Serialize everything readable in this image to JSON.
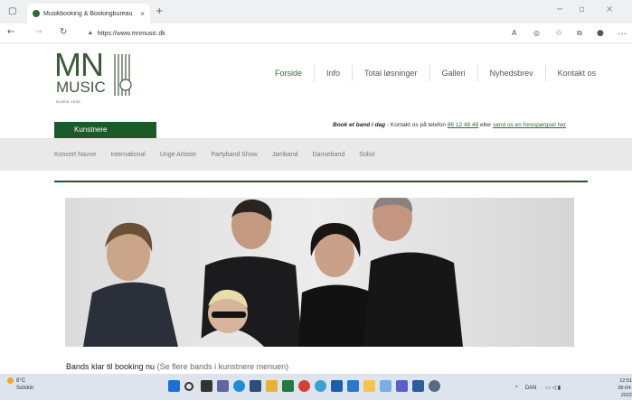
{
  "browser": {
    "tab_title": "Musikbooking & Bookingbureau",
    "url": "https://www.mnmusic.dk",
    "icons": [
      "tabs-icon",
      "back-icon",
      "forward-icon",
      "refresh-icon",
      "lock-icon",
      "read-aloud-icon",
      "extensions-icon",
      "favorites-icon",
      "collections-icon",
      "profile-icon",
      "more-icon"
    ]
  },
  "site": {
    "logo": {
      "main": "MN",
      "sub": "MUSIC",
      "since": "SIDEN 1992"
    },
    "nav": [
      "Forside",
      "Info",
      "Total løsninger",
      "Galleri",
      "Nyhedsbrev",
      "Kontakt os"
    ],
    "artists_button": "Kunstnere",
    "booking_line": {
      "bold": "Book et band i dag",
      "text1": " - Kontakt os på telefon ",
      "phone": "86 12 48 48",
      "text2": " eller ",
      "link": "send os en forespørgsel her"
    },
    "subnav": [
      "Koncert Navne",
      "International",
      "Unge Artister",
      "Partyband Show",
      "Jamband",
      "Danseband",
      "Solist"
    ],
    "caption": {
      "main": "Bands klar til booking nu",
      "sub": "(Se flere bands i kunstnere menuen)"
    }
  },
  "taskbar": {
    "weather_temp": "8°C",
    "weather_text": "Solskin",
    "tray_lang": "DAN",
    "time": "12:51",
    "date": "28-04-2022"
  },
  "colors": {
    "brand_green": "#1d5a2a",
    "nav_active": "#2f6b3a",
    "subnav_bg": "#e9e9e9"
  }
}
